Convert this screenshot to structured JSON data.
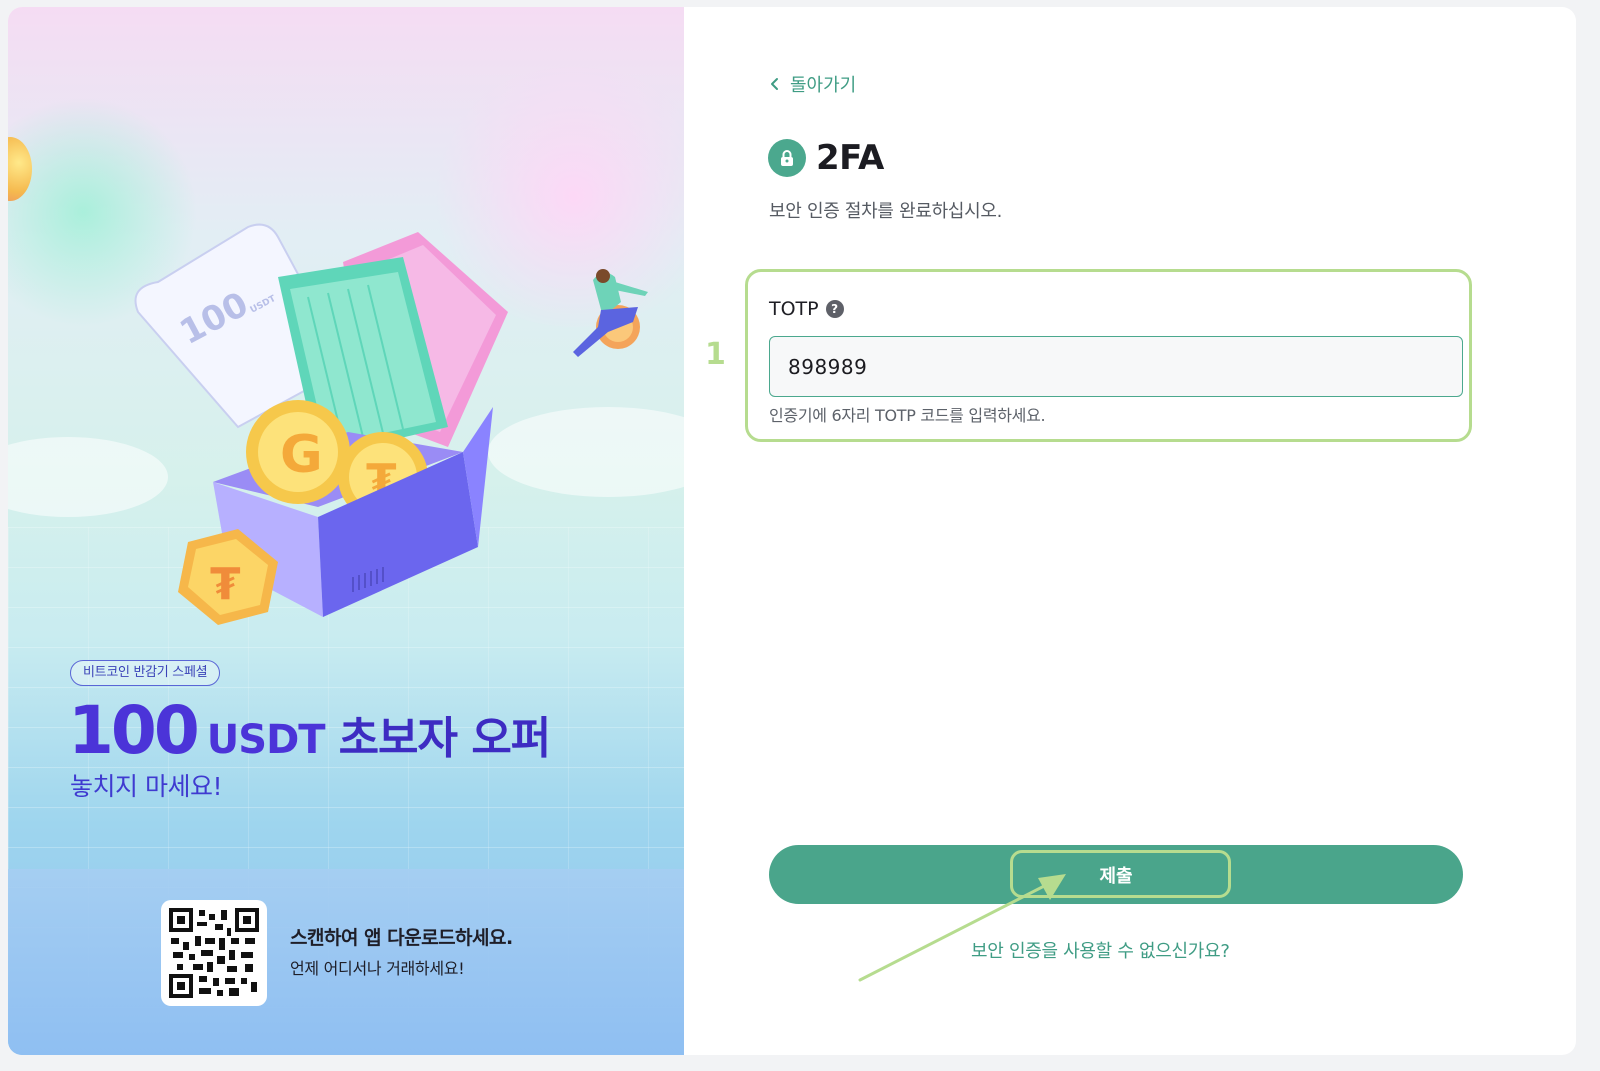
{
  "promo": {
    "badge": "비트코인 반감기 스페셜",
    "headline_amount": "100",
    "headline_unit": "USDT",
    "headline_rest": "초보자 오퍼",
    "subline": "놓치지 마세요!",
    "ticket_text": "100",
    "ticket_unit": "USDT",
    "qr_title": "스캔하여 앱 다운로드하세요.",
    "qr_subtitle": "언제 어디서나 거래하세요!"
  },
  "form": {
    "back_label": "돌아가기",
    "title": "2FA",
    "subtitle": "보안 인증 절차를 완료하십시오.",
    "field_label": "TOTP",
    "field_value": "898989",
    "field_hint": "인증기에 6자리 TOTP 코드를 입력하세요.",
    "submit_label": "제출",
    "no_2fa_link": "보안 인증을 사용할 수 없으신가요?"
  },
  "annotations": {
    "step_number": "1"
  },
  "icons": {
    "back": "chevron-left-icon",
    "title": "lock-icon",
    "help": "question-circle-icon"
  },
  "colors": {
    "accent": "#4aa58b",
    "link": "#3f9c84",
    "annotation": "#b6dc8f",
    "promo_text": "#4b34d8"
  }
}
